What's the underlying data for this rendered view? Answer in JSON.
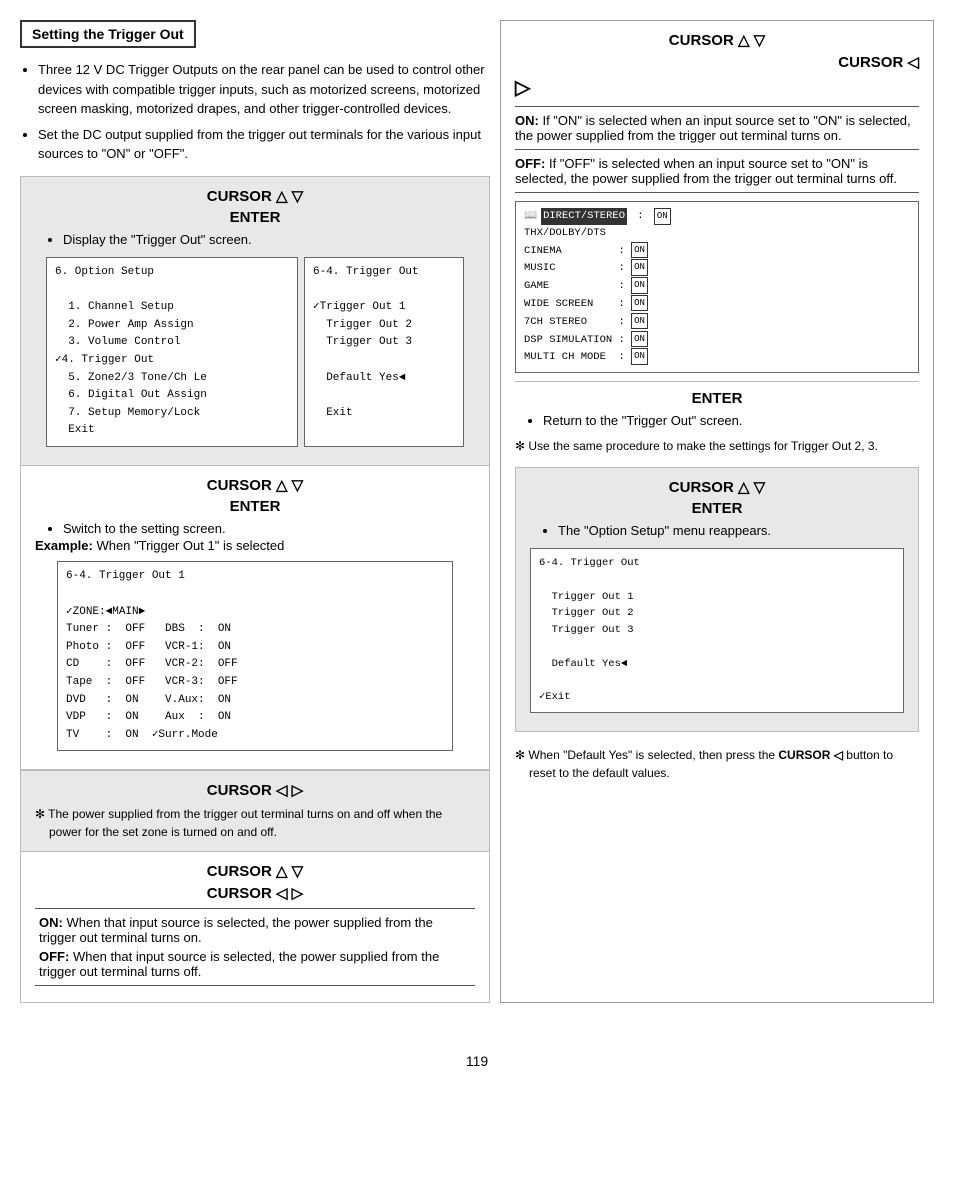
{
  "page": {
    "number": "119"
  },
  "title": "Setting the Trigger Out",
  "left": {
    "bullets": [
      "Three 12 V DC Trigger Outputs on the rear panel can be used to control other devices with compatible trigger inputs, such as motorized screens, motorized screen masking, motorized drapes, and other trigger-controlled devices.",
      "Set the DC output supplied from the trigger out terminals for the various input sources to \"ON\" or \"OFF\"."
    ],
    "section1": {
      "cursor": "CURSOR △ ▽",
      "enter": "ENTER",
      "enter_sub": "Display the \"Trigger Out\" screen.",
      "menu_left": [
        "6. Option Setup",
        "",
        "  1. Channel Setup",
        "  2. Power Amp Assign",
        "  3. Volume Control",
        "✓4. Trigger Out",
        "  5. Zone2/3 Tone/Ch Le",
        "  6. Digital Out Assign",
        "  7. Setup Memory/Lock",
        "  Exit"
      ],
      "menu_right": [
        "6-4. Trigger Out",
        "",
        "✓Trigger Out 1",
        "  Trigger Out 2",
        "  Trigger Out 3",
        "",
        "  Default Yes◄",
        "",
        "  Exit"
      ]
    },
    "section2": {
      "cursor": "CURSOR △ ▽",
      "enter": "ENTER",
      "enter_sub": "Switch to the setting screen.",
      "example_label": "Example:",
      "example_text": "When \"Trigger Out 1\" is selected",
      "screen_lines": [
        "6-4. Trigger Out 1",
        "",
        "✓ZONE:◄MAIN►",
        "Tuner :  OFF    DBS  :  ON",
        "Photo :  OFF    VCR-1:  ON",
        "CD    :  OFF    VCR-2:  OFF",
        "Tape  :  OFF    VCR-3:  OFF",
        "DVD   :  ON     V.Aux:  ON",
        "VDP   :  ON     Aux  :  ON",
        "TV    :  ON   ✓Surr.Mode"
      ]
    },
    "section3": {
      "cursor": "CURSOR ◁ ▷",
      "note": "The power supplied from the trigger out terminal turns on and off when the power for the set zone is turned on and off."
    },
    "section4": {
      "cursor1": "CURSOR △ ▽",
      "cursor2": "CURSOR ◁  ▷",
      "on_label": "ON:",
      "on_text": "When that input source is selected, the power supplied from the trigger out terminal turns on.",
      "off_label": "OFF:",
      "off_text": "When that input source is selected, the power supplied from the trigger out terminal turns off."
    }
  },
  "right": {
    "section1": {
      "cursor1": "CURSOR △  ▽",
      "cursor2": "CURSOR ◁",
      "arrow_right": "▷",
      "on_label": "ON:",
      "on_text": "If \"ON\" is selected when an input source set to \"ON\" is selected, the power supplied from the trigger out terminal turns on.",
      "off_label": "OFF:",
      "off_text": "If \"OFF\" is selected when an input source set to \"ON\" is selected, the power supplied from the trigger out terminal turns off.",
      "screen_lines": [
        "DIRECT/STEREO  :  ON",
        "THX/DOLBY/DTS",
        "CINEMA         :  ON",
        "MUSIC          :  ON",
        "GAME           :  ON",
        "WIDE SCREEN    :  ON",
        "7CH STEREO     :  ON",
        "DSP SIMULATION :  ON",
        "MULTI CH MODE  :  ON"
      ]
    },
    "section2": {
      "enter": "ENTER",
      "enter_sub": "Return to the \"Trigger Out\" screen.",
      "note": "Use the same procedure to make the settings for Trigger Out 2, 3."
    },
    "section3": {
      "cursor": "CURSOR △  ▽",
      "enter": "ENTER",
      "enter_sub": "The \"Option Setup\" menu reappears.",
      "screen_lines": [
        "6-4. Trigger Out",
        "",
        "  Trigger Out 1",
        "  Trigger Out 2",
        "  Trigger Out 3",
        "",
        "  Default Yes◄",
        "",
        "✓Exit"
      ]
    },
    "section4": {
      "note": "When \"Default Yes\" is selected, then press the CURSOR ◁ button to reset to the default values."
    }
  }
}
